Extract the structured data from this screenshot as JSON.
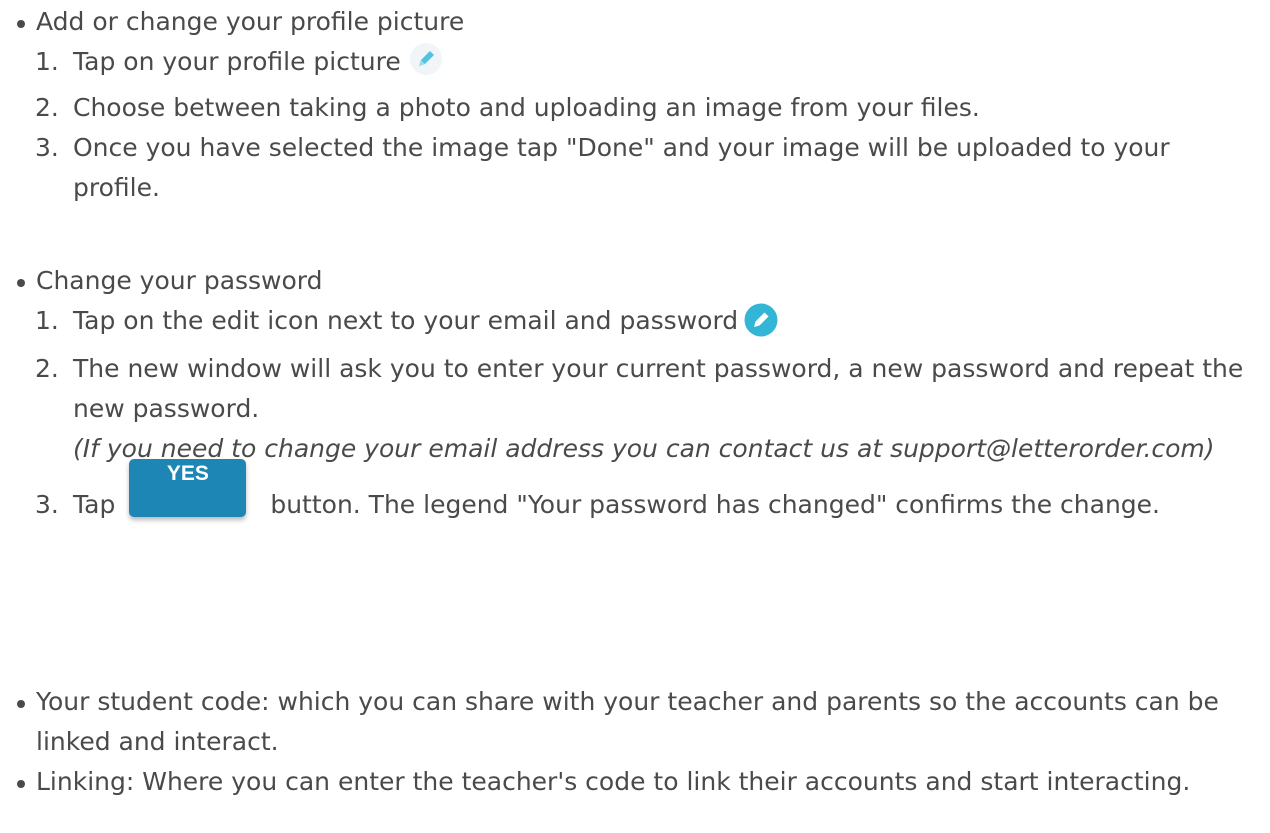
{
  "sections": [
    {
      "title": "Add or change your profile picture",
      "steps": [
        {
          "num": "1.",
          "text": "Tap on your profile picture"
        },
        {
          "num": "2.",
          "text": "Choose between taking a photo and uploading an image from your files."
        },
        {
          "num": "3.",
          "text": "Once you have selected the image tap \"Done\" and your image will be uploaded to your profile."
        }
      ]
    },
    {
      "title": "Change your password",
      "steps": [
        {
          "num": "1.",
          "text": "Tap on the edit icon next to your email and password"
        },
        {
          "num": "2.",
          "text": "The new window will ask you to enter your current password, a new password and repeat the new password.",
          "note": "(If you need to change your email address you can contact us at support@letterorder.com)"
        },
        {
          "num": "3.",
          "before": "Tap",
          "button": "YES",
          "after": "button. The legend \"Your password has changed\" confirms the change."
        }
      ]
    }
  ],
  "bullets": [
    "Your student code: which you can share with your teacher and parents so the accounts can be linked and interact.",
    "Linking: Where you can enter the teacher's code to link their accounts and start interacting."
  ],
  "icons": {
    "profile_pencil": "pencil-icon",
    "edit_pencil": "edit-pencil-icon",
    "accent": "#33b5d6",
    "button_color": "#1d86b5"
  }
}
